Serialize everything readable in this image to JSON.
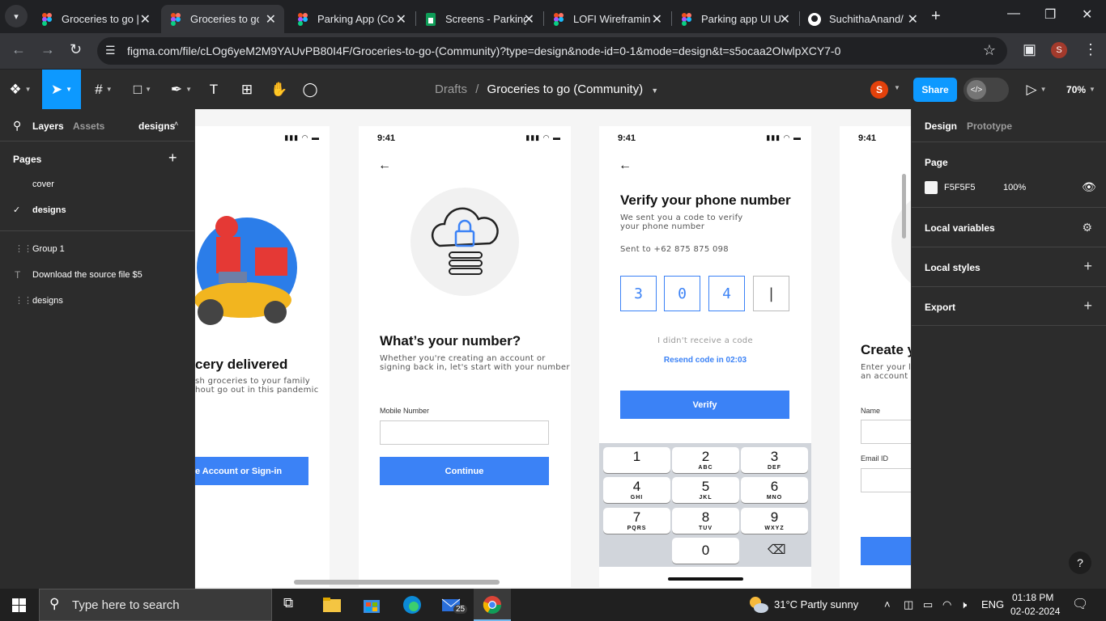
{
  "browser": {
    "tabs": [
      {
        "title": "Groceries to go |",
        "active": false
      },
      {
        "title": "Groceries to go |",
        "active": true
      },
      {
        "title": "Parking App (Co",
        "active": false
      },
      {
        "title": "Screens - Parking",
        "active": false
      },
      {
        "title": "LOFI Wireframin",
        "active": false
      },
      {
        "title": "Parking app UI U",
        "active": false
      },
      {
        "title": "SuchithaAnand/",
        "active": false
      }
    ],
    "url": "figma.com/file/cLOg6yeM2M9YAUvPB80I4F/Groceries-to-go-(Community)?type=design&node-id=0-1&mode=design&t=s5ocaa2OIwlpXCY7-0",
    "profile_initial": "S"
  },
  "figma": {
    "breadcrumb_root": "Drafts",
    "breadcrumb_sep": "/",
    "file_name": "Groceries to go (Community)",
    "user_initial": "S",
    "share_label": "Share",
    "zoom": "70%"
  },
  "left_panel": {
    "tab_layers": "Layers",
    "tab_assets": "Assets",
    "page_selector": "designs",
    "pages_title": "Pages",
    "pages": [
      "cover",
      "designs"
    ],
    "selected_page": "designs",
    "layers": [
      {
        "name": "Group 1",
        "type": "group"
      },
      {
        "name": "Download the source file $5",
        "type": "text"
      },
      {
        "name": "designs",
        "type": "group"
      }
    ]
  },
  "canvas": {
    "screen1": {
      "headline": "cery delivered",
      "body": "sh groceries to your family\nhout go out in  this pandemic",
      "cta": "e Account or Sign-in"
    },
    "screen2": {
      "time": "9:41",
      "headline": "What’s your number?",
      "body": "Whether you're creating an account or\nsigning back in, let's start with your number",
      "field_label": "Mobile Number",
      "cta": "Continue"
    },
    "screen3": {
      "time": "9:41",
      "headline": "Verify your phone number",
      "body": "We sent you a code to verify\nyour phone number",
      "sent_to": "Sent to +62 875 875 098",
      "otp": [
        "3",
        "0",
        "4",
        "|"
      ],
      "not_received": "I didn't receive a code",
      "resend": "Resend code in 02:03",
      "cta": "Verify",
      "keypad": [
        {
          "num": "1",
          "letters": ""
        },
        {
          "num": "2",
          "letters": "ABC"
        },
        {
          "num": "3",
          "letters": "DEF"
        },
        {
          "num": "4",
          "letters": "GHI"
        },
        {
          "num": "5",
          "letters": "JKL"
        },
        {
          "num": "6",
          "letters": "MNO"
        },
        {
          "num": "7",
          "letters": "PQRS"
        },
        {
          "num": "8",
          "letters": "TUV"
        },
        {
          "num": "9",
          "letters": "WXYZ"
        },
        {
          "num": "0",
          "letters": ""
        }
      ]
    },
    "screen4": {
      "time": "9:41",
      "headline": "Create y",
      "body": "Enter your li\nan account",
      "name_label": "Name",
      "email_label": "Email ID"
    }
  },
  "right_panel": {
    "tab_design": "Design",
    "tab_prototype": "Prototype",
    "page_title": "Page",
    "bg_hex": "F5F5F5",
    "bg_opacity": "100%",
    "sections": [
      "Local variables",
      "Local styles",
      "Export"
    ]
  },
  "taskbar": {
    "search_placeholder": "Type here to search",
    "mail_badge": "25",
    "weather": "31°C  Partly sunny",
    "lang": "ENG",
    "time": "01:18 PM",
    "date": "02-02-2024"
  },
  "colors": {
    "accent": "#0d99ff",
    "brand_blue": "#3b82f6",
    "canvas_bg": "#f5f5f5"
  }
}
